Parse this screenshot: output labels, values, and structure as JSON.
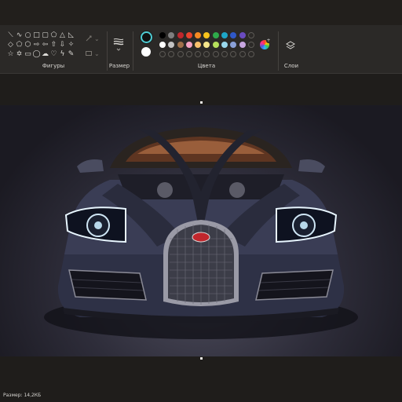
{
  "ribbon": {
    "shapes_label": "Фигуры",
    "size_label": "Размер",
    "colors_label": "Цвета",
    "layers_label": "Слои"
  },
  "shapes": [
    "line",
    "curve",
    "oval",
    "rectangle",
    "rounded-rectangle",
    "polygon",
    "triangle",
    "right-triangle",
    "diamond",
    "pentagon",
    "hexagon",
    "arrow-right",
    "arrow-left",
    "arrow-up",
    "arrow-down",
    "four-point-star",
    "five-point-star",
    "six-point-star",
    "rounded-callout",
    "oval-callout",
    "cloud-callout",
    "heart",
    "lightning",
    "pencil"
  ],
  "shape_glyphs": [
    "⟍",
    "∿",
    "○",
    "□",
    "▢",
    "⬠",
    "△",
    "◺",
    "◇",
    "⬠",
    "⬡",
    "⇨",
    "⇦",
    "⇧",
    "⇩",
    "✧",
    "☆",
    "✡",
    "▭",
    "◯",
    "☁",
    "♡",
    "ϟ",
    "✎"
  ],
  "colors": {
    "primary": "#111111",
    "secondary": "#ffffff",
    "palette_row1": [
      "#000000",
      "#7f7f7f",
      "#c0272d",
      "#e8432e",
      "#f58a22",
      "#f6c31c",
      "#2eaa4a",
      "#1da6c8",
      "#2f58c8",
      "#6a4bc0"
    ],
    "palette_row2": [
      "#ffffff",
      "#c3c3c3",
      "#a0704a",
      "#f5a3c3",
      "#f8c06d",
      "#f5e68c",
      "#b5e05c",
      "#9ad9ee",
      "#8aa0d8",
      "#c8a6e0"
    ]
  },
  "statusbar": {
    "size_text": "Размер: 14,2КБ"
  }
}
